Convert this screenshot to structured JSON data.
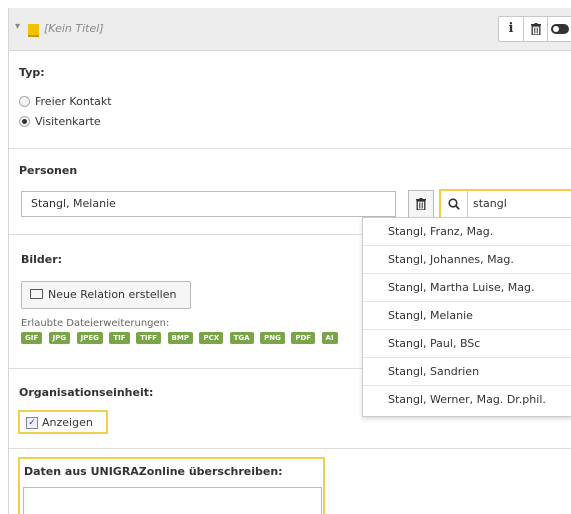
{
  "record": {
    "title": "[Kein Titel]",
    "header_buttons": [
      {
        "name": "info",
        "glyph": "i"
      },
      {
        "name": "delete",
        "glyph": "🗑"
      },
      {
        "name": "toggle",
        "glyph": "●"
      }
    ]
  },
  "typ": {
    "label": "Typ:",
    "options": [
      {
        "label": "Freier Kontakt",
        "checked": false
      },
      {
        "label": "Visitenkarte",
        "checked": true
      }
    ]
  },
  "personen": {
    "label": "Personen",
    "selected": "Stangl, Melanie",
    "search_query": "stangl",
    "suggestions": [
      "Stangl, Franz, Mag.",
      "Stangl, Johannes, Mag.",
      "Stangl, Martha Luise, Mag.",
      "Stangl, Melanie",
      "Stangl, Paul, BSc",
      "Stangl, Sandrien",
      "Stangl, Werner, Mag. Dr.phil."
    ]
  },
  "bilder": {
    "label": "Bilder:",
    "new_relation_label": "Neue Relation erstellen",
    "extensions_label": "Erlaubte Dateierweiterungen:",
    "extensions": [
      "GIF",
      "JPG",
      "JPEG",
      "TIF",
      "TIFF",
      "BMP",
      "PCX",
      "TGA",
      "PNG",
      "PDF",
      "AI"
    ]
  },
  "organisation": {
    "label": "Organisationseinheit:",
    "checkbox_label": "Anzeigen",
    "checked": true
  },
  "override": {
    "label": "Daten aus UNIGRAZonline überschreiben:",
    "value": ""
  },
  "colors": {
    "highlight": "#f0d04a",
    "extension_badge": "#79a548",
    "header_bg": "#ededed"
  }
}
